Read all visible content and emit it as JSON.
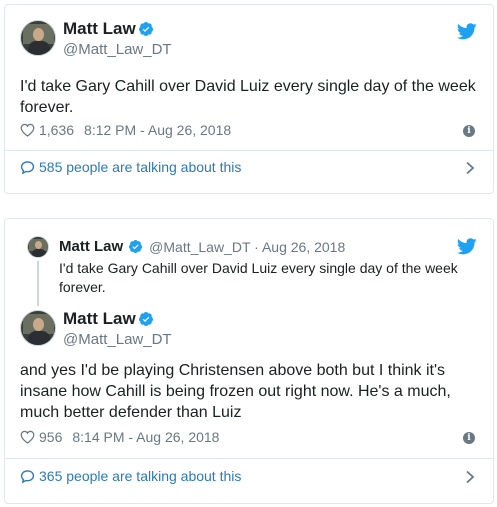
{
  "tweet1": {
    "name": "Matt Law",
    "handle": "@Matt_Law_DT",
    "text": "I'd take Gary Cahill over David Luiz every single day of the week forever.",
    "likes": "1,636",
    "timestamp": "8:12 PM - Aug 26, 2018",
    "talking": "585 people are talking about this"
  },
  "tweet2": {
    "quoted": {
      "name": "Matt Law",
      "handle_date": "@Matt_Law_DT · Aug 26, 2018",
      "text": "I'd take Gary Cahill over David Luiz every single day of the week forever."
    },
    "name": "Matt Law",
    "handle": "@Matt_Law_DT",
    "text": "and yes I'd be playing Christensen above both but I think it's insane how Cahill is being frozen out right now. He's a much, much better defender than Luiz",
    "likes": "956",
    "timestamp": "8:14 PM - Aug 26, 2018",
    "talking": "365 people are talking about this"
  },
  "colors": {
    "accent": "#1da1f2",
    "link": "#2b7bb9",
    "muted": "#697882",
    "border": "#e1e8ed"
  },
  "icons": {
    "verified": "verified-badge-icon",
    "bird": "twitter-bird-icon",
    "heart": "heart-icon",
    "info": "info-icon",
    "bubble": "speech-bubble-icon",
    "chevron": "chevron-right-icon"
  }
}
